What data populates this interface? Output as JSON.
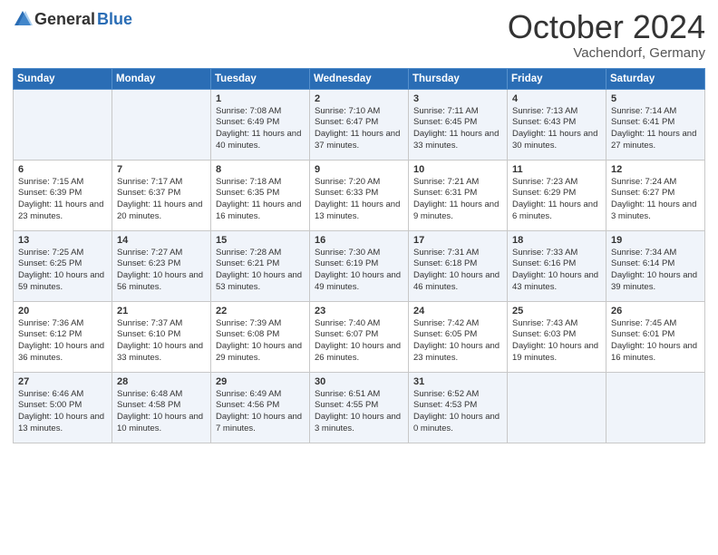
{
  "header": {
    "logo_general": "General",
    "logo_blue": "Blue",
    "month_title": "October 2024",
    "location": "Vachendorf, Germany"
  },
  "weekdays": [
    "Sunday",
    "Monday",
    "Tuesday",
    "Wednesday",
    "Thursday",
    "Friday",
    "Saturday"
  ],
  "rows": [
    [
      {
        "day": "",
        "text": ""
      },
      {
        "day": "",
        "text": ""
      },
      {
        "day": "1",
        "text": "Sunrise: 7:08 AM\nSunset: 6:49 PM\nDaylight: 11 hours and 40 minutes."
      },
      {
        "day": "2",
        "text": "Sunrise: 7:10 AM\nSunset: 6:47 PM\nDaylight: 11 hours and 37 minutes."
      },
      {
        "day": "3",
        "text": "Sunrise: 7:11 AM\nSunset: 6:45 PM\nDaylight: 11 hours and 33 minutes."
      },
      {
        "day": "4",
        "text": "Sunrise: 7:13 AM\nSunset: 6:43 PM\nDaylight: 11 hours and 30 minutes."
      },
      {
        "day": "5",
        "text": "Sunrise: 7:14 AM\nSunset: 6:41 PM\nDaylight: 11 hours and 27 minutes."
      }
    ],
    [
      {
        "day": "6",
        "text": "Sunrise: 7:15 AM\nSunset: 6:39 PM\nDaylight: 11 hours and 23 minutes."
      },
      {
        "day": "7",
        "text": "Sunrise: 7:17 AM\nSunset: 6:37 PM\nDaylight: 11 hours and 20 minutes."
      },
      {
        "day": "8",
        "text": "Sunrise: 7:18 AM\nSunset: 6:35 PM\nDaylight: 11 hours and 16 minutes."
      },
      {
        "day": "9",
        "text": "Sunrise: 7:20 AM\nSunset: 6:33 PM\nDaylight: 11 hours and 13 minutes."
      },
      {
        "day": "10",
        "text": "Sunrise: 7:21 AM\nSunset: 6:31 PM\nDaylight: 11 hours and 9 minutes."
      },
      {
        "day": "11",
        "text": "Sunrise: 7:23 AM\nSunset: 6:29 PM\nDaylight: 11 hours and 6 minutes."
      },
      {
        "day": "12",
        "text": "Sunrise: 7:24 AM\nSunset: 6:27 PM\nDaylight: 11 hours and 3 minutes."
      }
    ],
    [
      {
        "day": "13",
        "text": "Sunrise: 7:25 AM\nSunset: 6:25 PM\nDaylight: 10 hours and 59 minutes."
      },
      {
        "day": "14",
        "text": "Sunrise: 7:27 AM\nSunset: 6:23 PM\nDaylight: 10 hours and 56 minutes."
      },
      {
        "day": "15",
        "text": "Sunrise: 7:28 AM\nSunset: 6:21 PM\nDaylight: 10 hours and 53 minutes."
      },
      {
        "day": "16",
        "text": "Sunrise: 7:30 AM\nSunset: 6:19 PM\nDaylight: 10 hours and 49 minutes."
      },
      {
        "day": "17",
        "text": "Sunrise: 7:31 AM\nSunset: 6:18 PM\nDaylight: 10 hours and 46 minutes."
      },
      {
        "day": "18",
        "text": "Sunrise: 7:33 AM\nSunset: 6:16 PM\nDaylight: 10 hours and 43 minutes."
      },
      {
        "day": "19",
        "text": "Sunrise: 7:34 AM\nSunset: 6:14 PM\nDaylight: 10 hours and 39 minutes."
      }
    ],
    [
      {
        "day": "20",
        "text": "Sunrise: 7:36 AM\nSunset: 6:12 PM\nDaylight: 10 hours and 36 minutes."
      },
      {
        "day": "21",
        "text": "Sunrise: 7:37 AM\nSunset: 6:10 PM\nDaylight: 10 hours and 33 minutes."
      },
      {
        "day": "22",
        "text": "Sunrise: 7:39 AM\nSunset: 6:08 PM\nDaylight: 10 hours and 29 minutes."
      },
      {
        "day": "23",
        "text": "Sunrise: 7:40 AM\nSunset: 6:07 PM\nDaylight: 10 hours and 26 minutes."
      },
      {
        "day": "24",
        "text": "Sunrise: 7:42 AM\nSunset: 6:05 PM\nDaylight: 10 hours and 23 minutes."
      },
      {
        "day": "25",
        "text": "Sunrise: 7:43 AM\nSunset: 6:03 PM\nDaylight: 10 hours and 19 minutes."
      },
      {
        "day": "26",
        "text": "Sunrise: 7:45 AM\nSunset: 6:01 PM\nDaylight: 10 hours and 16 minutes."
      }
    ],
    [
      {
        "day": "27",
        "text": "Sunrise: 6:46 AM\nSunset: 5:00 PM\nDaylight: 10 hours and 13 minutes."
      },
      {
        "day": "28",
        "text": "Sunrise: 6:48 AM\nSunset: 4:58 PM\nDaylight: 10 hours and 10 minutes."
      },
      {
        "day": "29",
        "text": "Sunrise: 6:49 AM\nSunset: 4:56 PM\nDaylight: 10 hours and 7 minutes."
      },
      {
        "day": "30",
        "text": "Sunrise: 6:51 AM\nSunset: 4:55 PM\nDaylight: 10 hours and 3 minutes."
      },
      {
        "day": "31",
        "text": "Sunrise: 6:52 AM\nSunset: 4:53 PM\nDaylight: 10 hours and 0 minutes."
      },
      {
        "day": "",
        "text": ""
      },
      {
        "day": "",
        "text": ""
      }
    ]
  ]
}
